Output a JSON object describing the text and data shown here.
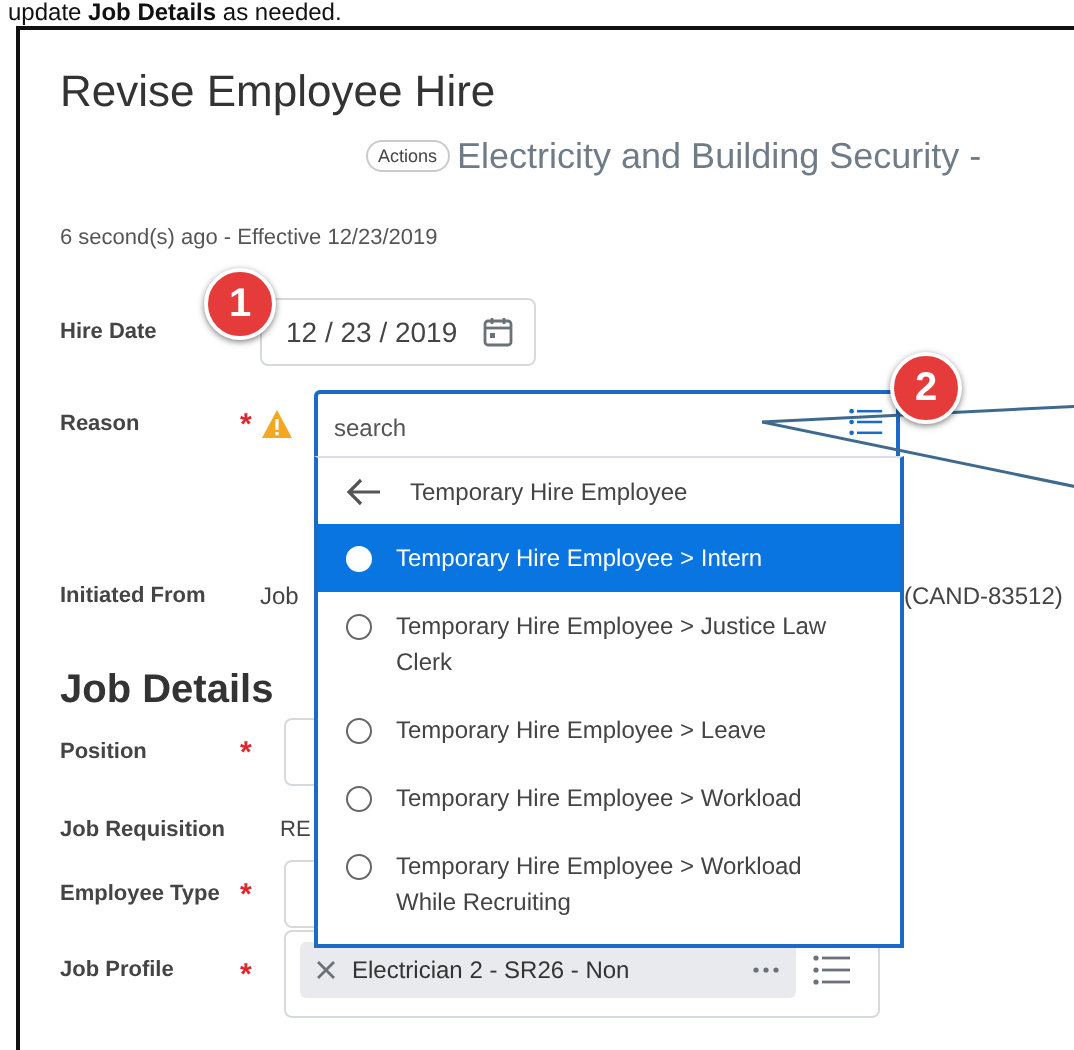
{
  "caption": "update **Job Details** as needed.",
  "title": "Revise Employee Hire",
  "actions_label": "Actions",
  "subject": "Electricity and Building Security -",
  "meta": "6 second(s) ago -  Effective 12/23/2019",
  "hire_date": {
    "label": "Hire Date",
    "value": "12 / 23 / 2019"
  },
  "reason": {
    "label": "Reason",
    "required_mark": "*",
    "warning": true,
    "placeholder": "search"
  },
  "initiated_from": {
    "label": "Initiated From",
    "value_start": "Job",
    "value_end": "(CAND-83512)"
  },
  "dropdown": {
    "back_label": "Temporary Hire Employee",
    "options": [
      {
        "label": "Temporary Hire Employee > Intern",
        "selected": true
      },
      {
        "label": "Temporary Hire Employee > Justice Law Clerk",
        "selected": false
      },
      {
        "label": "Temporary Hire Employee > Leave",
        "selected": false
      },
      {
        "label": "Temporary Hire Employee > Workload",
        "selected": false
      },
      {
        "label": "Temporary Hire Employee > Workload While Recruiting",
        "selected": false
      }
    ]
  },
  "job_details": {
    "heading": "Job Details",
    "fields": [
      {
        "kind": "box",
        "label": "Position",
        "required_mark": "*"
      },
      {
        "kind": "text",
        "label": "Job Requisition",
        "value": "RE"
      },
      {
        "kind": "box",
        "label": "Employee Type",
        "required_mark": "*"
      },
      {
        "kind": "chip",
        "label": "Job Profile",
        "required_mark": "*",
        "chip": "Electrician 2 - SR26 - Non"
      }
    ]
  },
  "callouts": [
    {
      "number": "1"
    },
    {
      "number": "2"
    }
  ]
}
